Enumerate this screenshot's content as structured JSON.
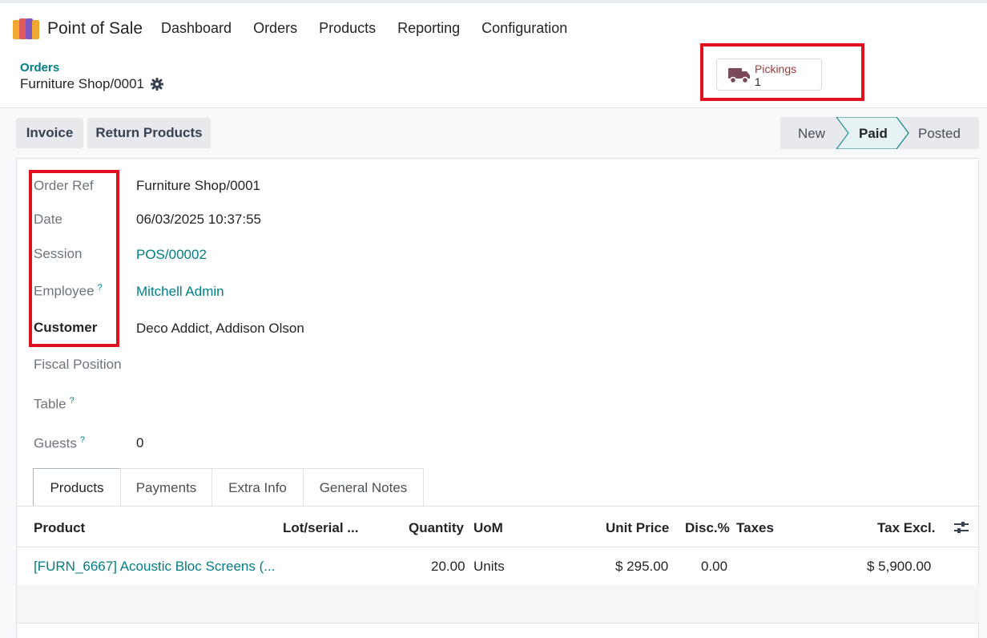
{
  "navbar": {
    "app_name": "Point of Sale",
    "menu": [
      "Dashboard",
      "Orders",
      "Products",
      "Reporting",
      "Configuration"
    ]
  },
  "breadcrumb": {
    "parent": "Orders",
    "current": "Furniture Shop/0001"
  },
  "smart_button": {
    "label": "Pickings",
    "count": "1",
    "icon": "truck-icon"
  },
  "actions": {
    "invoice": "Invoice",
    "return_products": "Return Products"
  },
  "status": {
    "stages": [
      "New",
      "Paid",
      "Posted"
    ],
    "current": "Paid"
  },
  "form": {
    "order_ref": {
      "label": "Order Ref",
      "value": "Furniture Shop/0001"
    },
    "date": {
      "label": "Date",
      "value": "06/03/2025 10:37:55"
    },
    "session": {
      "label": "Session",
      "value": "POS/00002"
    },
    "employee": {
      "label": "Employee",
      "help": "?",
      "value": "Mitchell Admin"
    },
    "customer": {
      "label": "Customer",
      "value": "Deco Addict, Addison Olson"
    },
    "fiscal_position": {
      "label": "Fiscal Position",
      "value": ""
    },
    "table": {
      "label": "Table",
      "help": "?",
      "value": ""
    },
    "guests": {
      "label": "Guests",
      "help": "?",
      "value": "0"
    }
  },
  "tabs": [
    "Products",
    "Payments",
    "Extra Info",
    "General Notes"
  ],
  "lines": {
    "columns": {
      "product": "Product",
      "lot": "Lot/serial ...",
      "quantity": "Quantity",
      "uom": "UoM",
      "unit_price": "Unit Price",
      "discount": "Disc.%",
      "taxes": "Taxes",
      "tax_excl": "Tax Excl."
    },
    "rows": [
      {
        "product": "[FURN_6667] Acoustic Bloc Screens (...",
        "lot": "",
        "quantity": "20.00",
        "uom": "Units",
        "unit_price": "$ 295.00",
        "discount": "0.00",
        "taxes": "",
        "tax_excl": "$ 5,900.00"
      }
    ]
  },
  "colors": {
    "accent": "#017e84",
    "highlight": "#e0101e",
    "picking_label": "#9a3c3c"
  }
}
